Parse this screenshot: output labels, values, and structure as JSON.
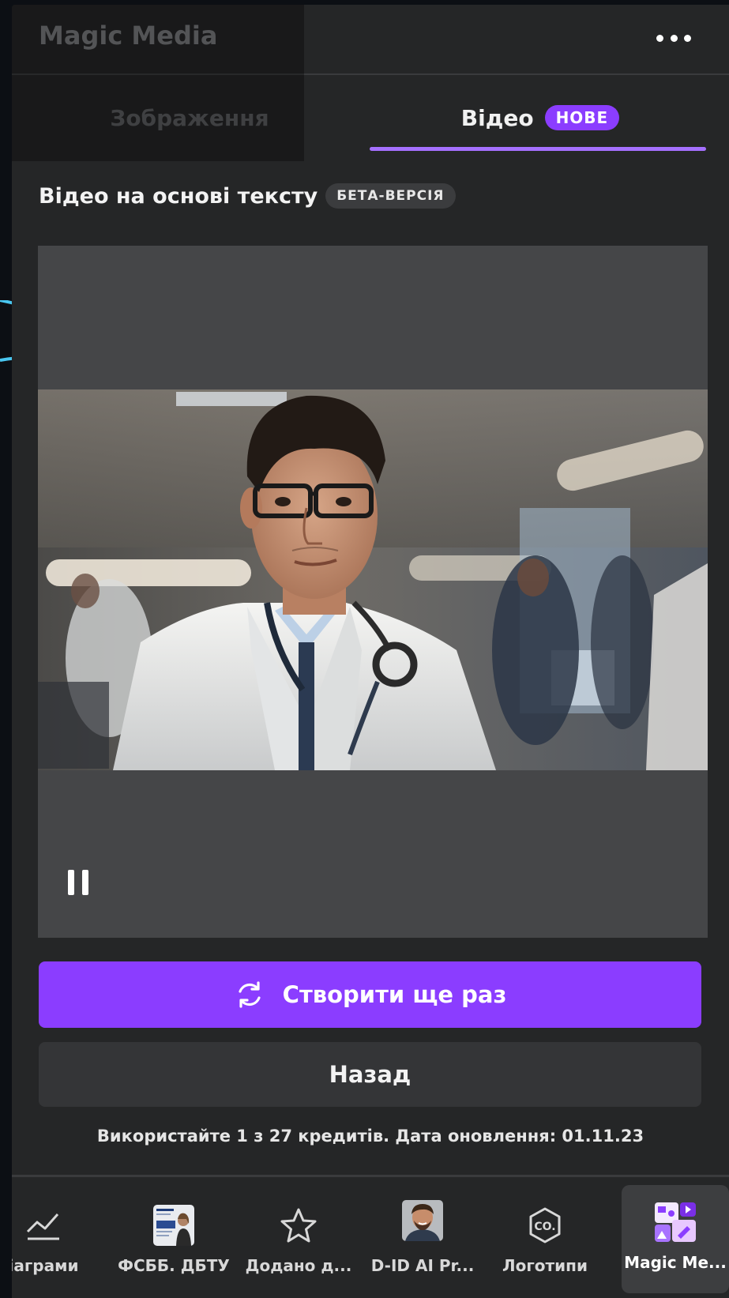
{
  "header": {
    "title": "Magic Media",
    "more_icon": "more-horizontal-icon"
  },
  "tabs": [
    {
      "label": "Зображення",
      "active": false
    },
    {
      "label": "Відео",
      "active": true,
      "badge": "НОВЕ"
    }
  ],
  "section": {
    "title": "Відео на основі тексту",
    "badge": "БЕТА-ВЕРСІЯ"
  },
  "video": {
    "state": "playing",
    "control_icon": "pause-icon"
  },
  "buttons": {
    "regenerate_label": "Створити ще раз",
    "regenerate_icon": "refresh-icon",
    "back_label": "Назад"
  },
  "credits_note": "Використайте 1 з 27 кредитів. Дата оновлення: 01.11.23",
  "bottom_nav": [
    {
      "label": "іаграми",
      "icon": "line-chart-icon",
      "active": false
    },
    {
      "label": "ФСББ. ДБТУ",
      "icon": "document-thumbnail-icon",
      "active": false
    },
    {
      "label": "Додано д...",
      "icon": "star-icon",
      "active": false
    },
    {
      "label": "D-ID AI Pr...",
      "icon": "avatar-thumbnail-icon",
      "active": false
    },
    {
      "label": "Логотипи",
      "icon": "co-logo-icon",
      "active": false
    },
    {
      "label": "Magic Me...",
      "icon": "magic-media-icon",
      "active": true
    }
  ],
  "colors": {
    "accent": "#8b3dff",
    "tab_underline": "#a570ff",
    "panel_bg": "#252627",
    "video_bg": "#454648",
    "page_bg": "#0c0f14"
  }
}
